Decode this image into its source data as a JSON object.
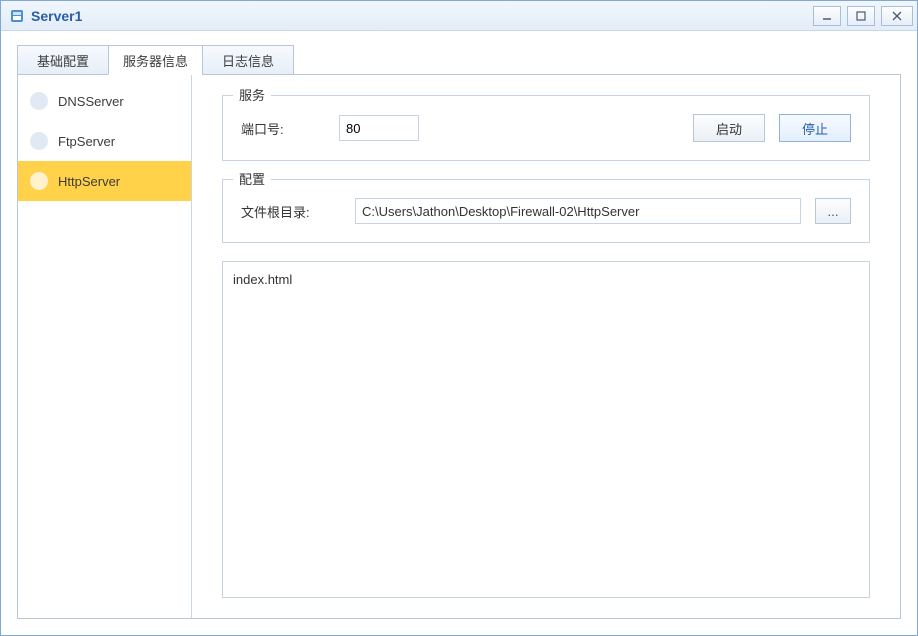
{
  "window": {
    "title": "Server1"
  },
  "tabs": [
    {
      "label": "基础配置",
      "active": false
    },
    {
      "label": "服务器信息",
      "active": true
    },
    {
      "label": "日志信息",
      "active": false
    }
  ],
  "sidebar": {
    "items": [
      {
        "label": "DNSServer",
        "active": false
      },
      {
        "label": "FtpServer",
        "active": false
      },
      {
        "label": "HttpServer",
        "active": true
      }
    ]
  },
  "service_group": {
    "legend": "服务",
    "port_label": "端口号:",
    "port_value": "80",
    "start_label": "启动",
    "stop_label": "停止"
  },
  "config_group": {
    "legend": "配置",
    "root_label": "文件根目录:",
    "root_value": "C:\\Users\\Jathon\\Desktop\\Firewall-02\\HttpServer",
    "browse_label": "..."
  },
  "file_list": {
    "items": [
      {
        "name": "index.html"
      }
    ]
  }
}
